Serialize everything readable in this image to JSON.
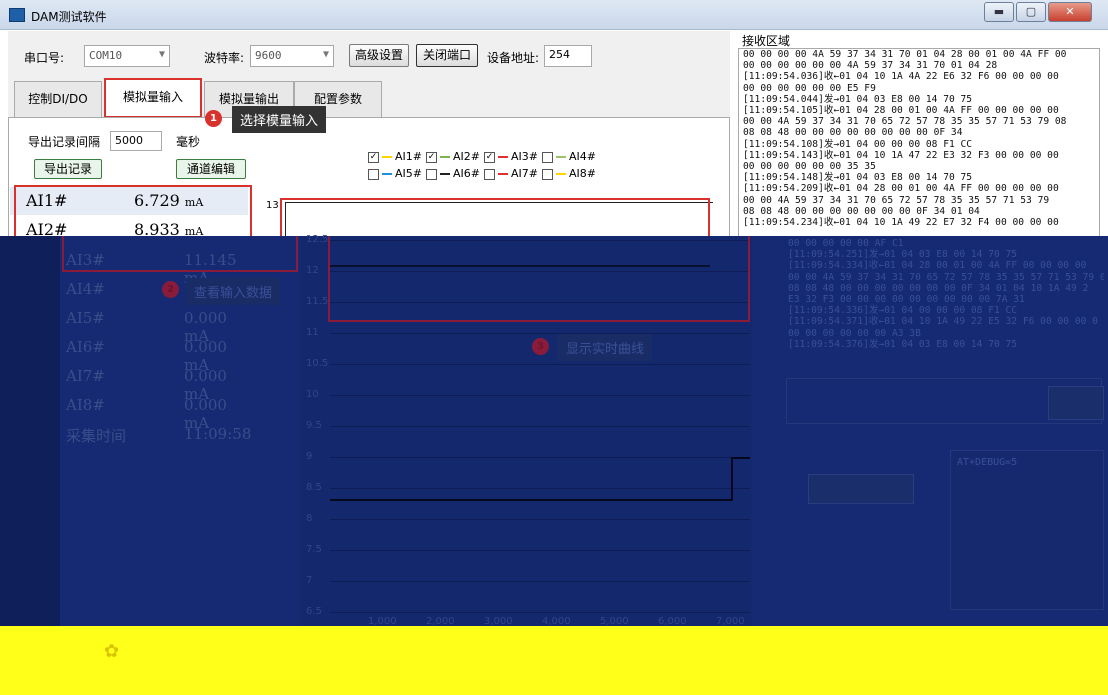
{
  "window": {
    "title": "DAM测试软件",
    "min": "▬",
    "max": "▢",
    "close": "✕"
  },
  "toolbar": {
    "port_label": "串口号:",
    "port_value": "COM10",
    "baud_label": "波特率:",
    "baud_value": "9600",
    "advanced_btn": "高级设置",
    "close_port_btn": "关闭端口",
    "addr_label": "设备地址:",
    "addr_value": "254"
  },
  "tabs": [
    "控制DI/DO",
    "模拟量输入",
    "模拟量输出",
    "配置参数"
  ],
  "tip1": {
    "num": "1",
    "text": "选择模量输入"
  },
  "export": {
    "interval_label": "导出记录间隔",
    "interval_value": "5000",
    "unit": "毫秒",
    "export_btn": "导出记录",
    "channel_btn": "通道编辑"
  },
  "ai_rows": [
    {
      "name": "AI1#",
      "value": "6.729",
      "unit": "mA"
    },
    {
      "name": "AI2#",
      "value": "8.933",
      "unit": "mA"
    }
  ],
  "dark_ai_rows": [
    {
      "name": "AI3#",
      "value": "11.145 mA"
    },
    {
      "name": "AI4#",
      "value": ""
    },
    {
      "name": "AI5#",
      "value": "0.000 mA"
    },
    {
      "name": "AI6#",
      "value": "0.000 mA"
    },
    {
      "name": "AI7#",
      "value": "0.000 mA"
    },
    {
      "name": "AI8#",
      "value": "0.000 mA"
    },
    {
      "name": "采集时间",
      "value": "11:09:58"
    }
  ],
  "tip2": {
    "num": "2",
    "text": "查看输入数据"
  },
  "tip3": {
    "num": "3",
    "text": "显示实时曲线"
  },
  "legend": [
    {
      "label": "AI1#",
      "checked": true,
      "color": "#ffd400"
    },
    {
      "label": "AI2#",
      "checked": true,
      "color": "#7ab648"
    },
    {
      "label": "AI3#",
      "checked": true,
      "color": "#e03030"
    },
    {
      "label": "AI4#",
      "checked": false,
      "color": "#9cc26a"
    },
    {
      "label": "AI5#",
      "checked": false,
      "color": "#1f8fe0"
    },
    {
      "label": "AI6#",
      "checked": false,
      "color": "#222222"
    },
    {
      "label": "AI7#",
      "checked": false,
      "color": "#e03030"
    },
    {
      "label": "AI8#",
      "checked": false,
      "color": "#ffd400"
    }
  ],
  "chart_yticks": [
    "13",
    "12.5",
    "12",
    "11.5",
    "11",
    "10.5",
    "10",
    "9.5",
    "9",
    "8.5",
    "8",
    "7.5",
    "7",
    "6.5"
  ],
  "chart_xticks": [
    "1,000",
    "2,000",
    "3,000",
    "4,000",
    "5,000",
    "6,000",
    "7,000"
  ],
  "recv": {
    "title": "接收区域",
    "lines": [
      "00 00 00 00 4A 59 37 34 31 70 01 04 28 00 01 00 4A FF 00",
      "00 00 00 00 00 00 4A 59 37 34 31 70 01 04 28",
      "[11:09:54.036]收←01 04 10 1A 4A 22 E6 32 F6 00 00 00 00",
      "00 00 00 00 00 00 E5 F9",
      "[11:09:54.044]发→01 04 03 E8 00 14 70 75",
      "[11:09:54.105]收←01 04 28 00 01 00 4A FF 00 00 00 00 00",
      "00 00 4A 59 37 34 31 70 65 72 57 78 35 35 57 71 53 79 08",
      "08 08 48 00 00 00 00 00 00 00 00 0F 34",
      "[11:09:54.108]发→01 04 00 00 00 08 F1 CC",
      "[11:09:54.143]收←01 04 10 1A 47 22 E3 32 F3 00 00 00 00",
      "00 00 00 00 00 00 35 35",
      "[11:09:54.148]发→01 04 03 E8 00 14 70 75",
      "[11:09:54.209]收←01 04 28 00 01 00 4A FF 00 00 00 00 00",
      "00 00 4A 59 37 34 31 70 65 72 57 78 35 35 57 71 53 79",
      "08 08 48 00 00 00 00 00 00 00 0F 34 01 04",
      "[11:09:54.234]收←01 04 10 1A 49 22 E7 32 F4 00 00 00 00"
    ],
    "dark_lines": [
      "00 00 00 00 00 AF C1",
      "[11:09:54.251]发→01 04 03 E8 00 14 70 75",
      "[11:09:54.334]收←01 04 28 00 01 00 4A FF 00 00 00 00",
      "00 00 4A 59 37 34 31 70 65 72 57 78 35 35 57 71 53 79 0",
      "08 08 48 00 00 00 00 00 00 00 0F 34 01 04 10 1A 49 2",
      "E3 32 F3 00 00 00 00 00 00 00 00 00 7A 31",
      "[11:09:54.336]发→01 04 00 00 00 08 F1 CC",
      "[11:09:54.371]收←01 04 10 1A 49 22 E5 32 F6 00 00 00 0",
      "00 00 00 00 00 00 A3 3B",
      "[11:09:54.376]发→01 04 03 E8 00 14 70 75"
    ],
    "debug_text": "AT+DEBUG=5"
  }
}
